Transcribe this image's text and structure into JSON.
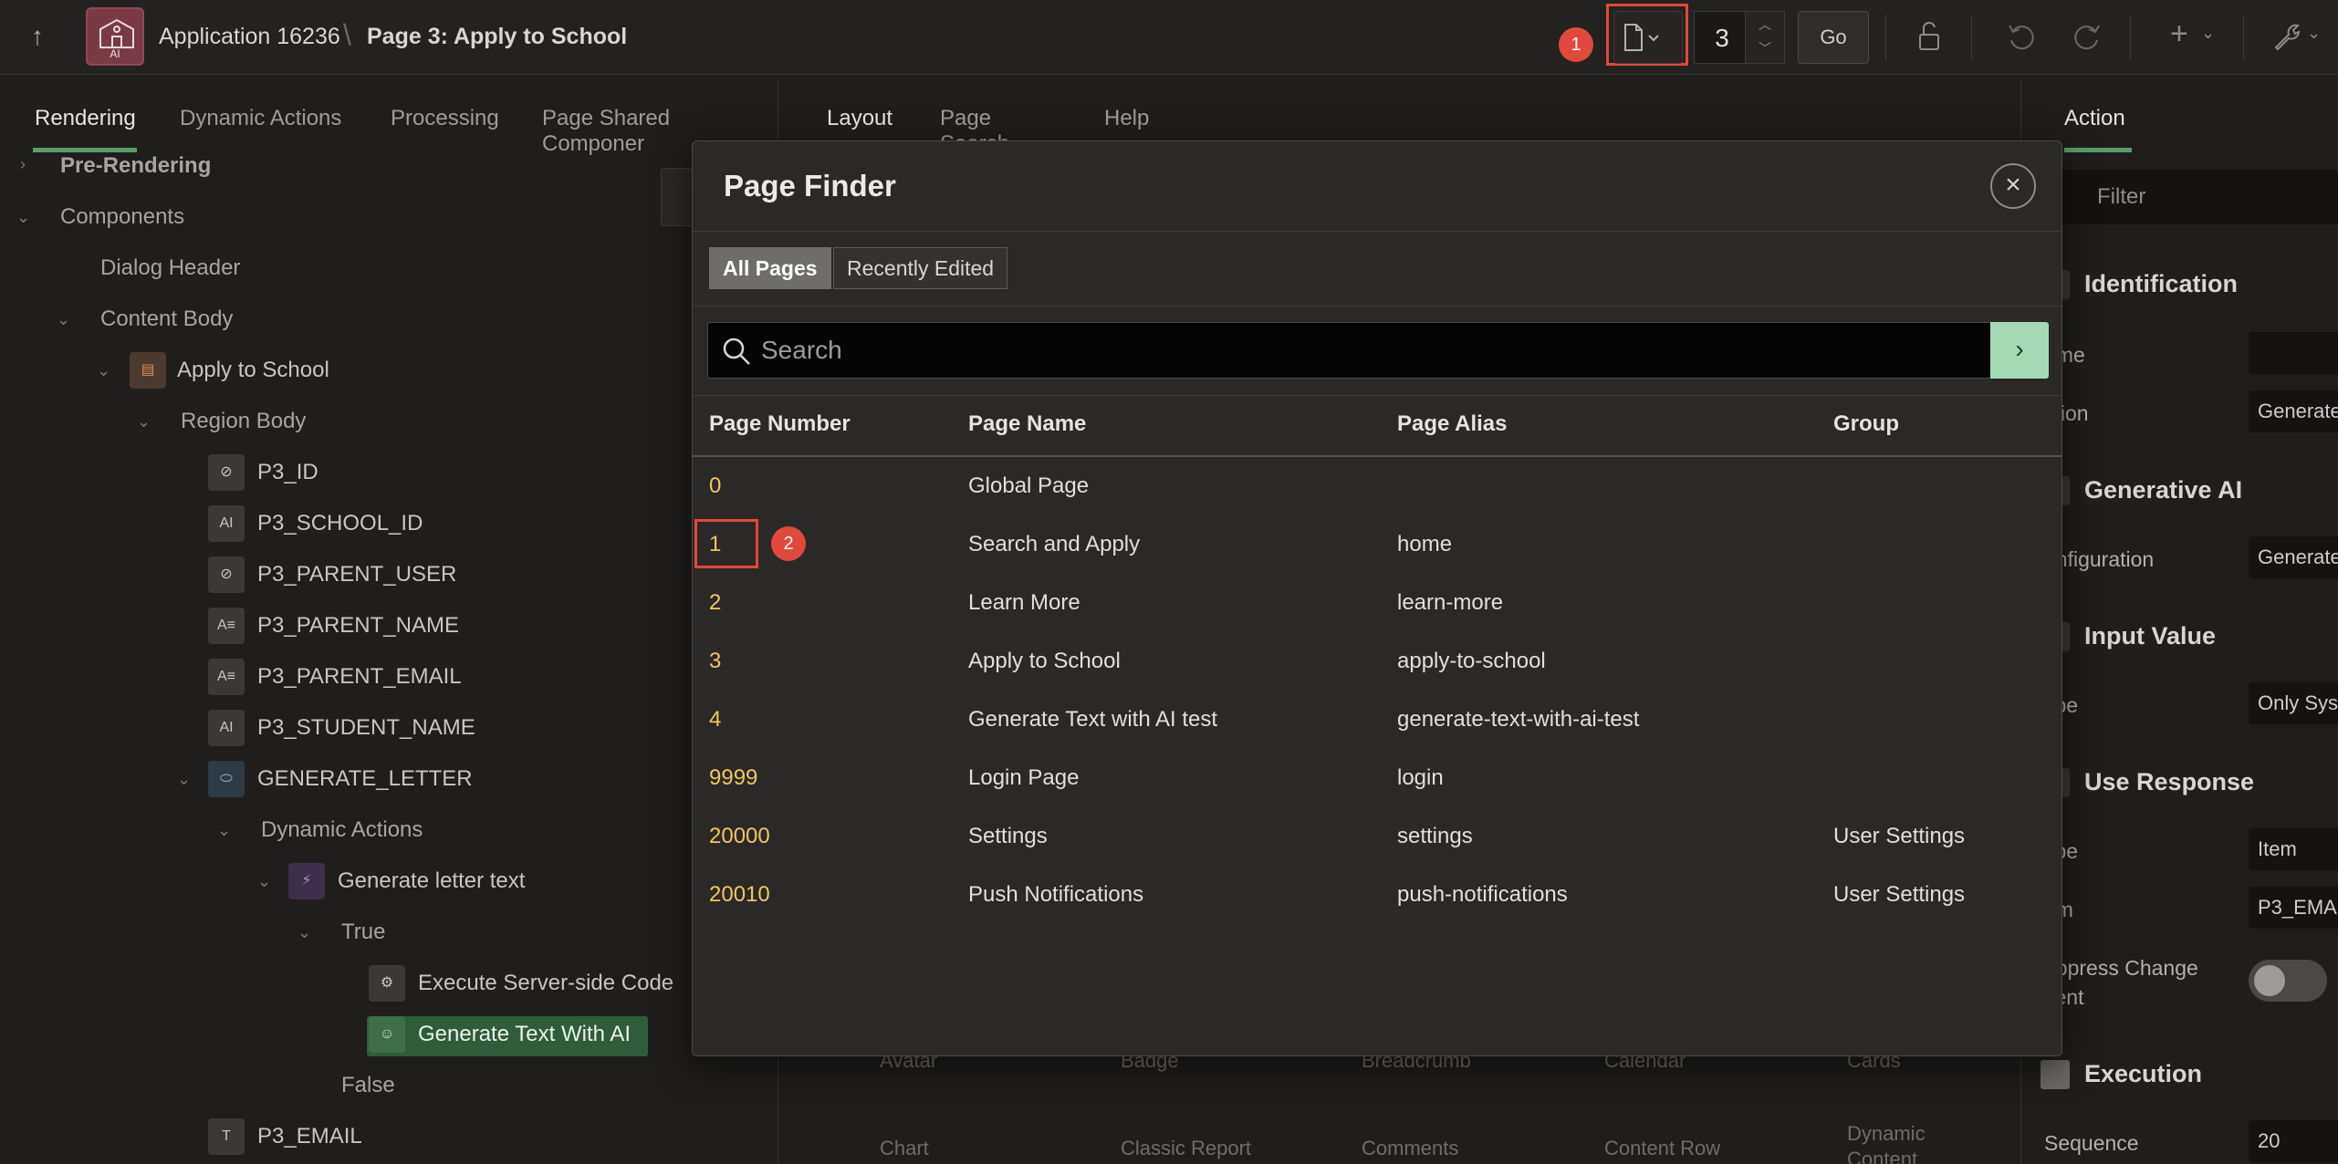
{
  "topbar": {
    "app_name": "Application 16236",
    "separator": "\\",
    "page_name": "Page 3: Apply to School",
    "app_icon_label": "AI",
    "page_number": "3",
    "go_label": "Go",
    "marker_1": "1"
  },
  "left_tabs": [
    "Rendering",
    "Dynamic Actions",
    "Processing",
    "Page Shared Componer"
  ],
  "mid_tabs": [
    "Layout",
    "Page Search",
    "Help"
  ],
  "right_tab": "Action",
  "tree": [
    {
      "label": "Pre-Rendering"
    },
    {
      "label": "Components"
    },
    {
      "label": "Dialog Header"
    },
    {
      "label": "Content Body"
    },
    {
      "label": "Apply to School"
    },
    {
      "label": "Region Body"
    },
    {
      "label": "P3_ID"
    },
    {
      "label": "P3_SCHOOL_ID"
    },
    {
      "label": "P3_PARENT_USER"
    },
    {
      "label": "P3_PARENT_NAME"
    },
    {
      "label": "P3_PARENT_EMAIL"
    },
    {
      "label": "P3_STUDENT_NAME"
    },
    {
      "label": "GENERATE_LETTER"
    },
    {
      "label": "Dynamic Actions"
    },
    {
      "label": "Generate letter text"
    },
    {
      "label": "True"
    },
    {
      "label": "Execute Server-side Code"
    },
    {
      "label": "Generate Text With AI"
    },
    {
      "label": "False"
    },
    {
      "label": "P3_EMAIL"
    }
  ],
  "right_panel": {
    "filter_placeholder": "Filter",
    "sections": [
      "Identification",
      "Generative AI",
      "Input Value",
      "Use Response",
      "Execution"
    ],
    "labels": [
      "ame",
      "ction",
      "onfiguration",
      "ype",
      "ype",
      "em",
      "uppress Change",
      "vent",
      "Sequence"
    ],
    "fields": [
      "",
      "Generate",
      "Generate",
      "Only Sys",
      "Item",
      "P3_EMA",
      "20"
    ]
  },
  "gallery": [
    "Avatar",
    "Badge",
    "Breadcrumb",
    "Calendar",
    "Cards",
    "Chart",
    "Classic Report",
    "Comments",
    "Content Row",
    "Dynamic",
    "Content"
  ],
  "modal": {
    "title": "Page Finder",
    "segments": [
      "All Pages",
      "Recently Edited"
    ],
    "search_placeholder": "Search",
    "columns": [
      "Page Number",
      "Page Name",
      "Page Alias",
      "Group"
    ],
    "rows": [
      {
        "number": "0",
        "name": "Global Page",
        "alias": "",
        "group": ""
      },
      {
        "number": "1",
        "name": "Search and Apply",
        "alias": "home",
        "group": ""
      },
      {
        "number": "2",
        "name": "Learn More",
        "alias": "learn-more",
        "group": ""
      },
      {
        "number": "3",
        "name": "Apply to School",
        "alias": "apply-to-school",
        "group": ""
      },
      {
        "number": "4",
        "name": "Generate Text with AI test",
        "alias": "generate-text-with-ai-test",
        "group": ""
      },
      {
        "number": "9999",
        "name": "Login Page",
        "alias": "login",
        "group": ""
      },
      {
        "number": "20000",
        "name": "Settings",
        "alias": "settings",
        "group": "User Settings"
      },
      {
        "number": "20010",
        "name": "Push Notifications",
        "alias": "push-notifications",
        "group": "User Settings"
      }
    ],
    "marker_2": "2"
  },
  "colors": {
    "accent_green": "#5d9c6a",
    "marker_red": "#e0493b",
    "page_number_yellow": "#f0c75e",
    "selected_tree": "#2f5c3a"
  }
}
